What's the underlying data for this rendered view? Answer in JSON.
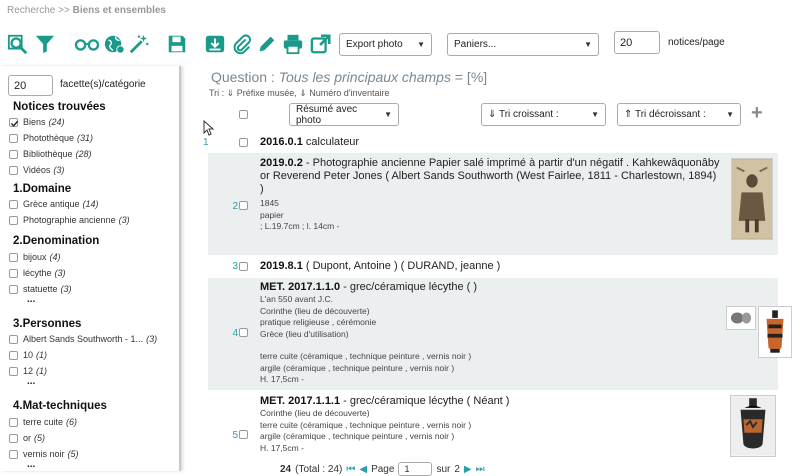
{
  "breadcrumb": {
    "root": "Recherche",
    "sep": ">>",
    "current": "Biens et ensembles"
  },
  "toolbar": {
    "export_photo": "Export photo",
    "paniers": "Paniers...",
    "per_page_value": "20",
    "per_page_label": "notices/page"
  },
  "sidebar": {
    "facet_count_value": "20",
    "facet_label": "facette(s)/catégorie",
    "found_title": "Notices trouvées",
    "found_items": [
      {
        "label": "Biens",
        "count": "(24)",
        "checked": true
      },
      {
        "label": "Photothèque",
        "count": "(31)"
      },
      {
        "label": "Bibliothèque",
        "count": "(28)"
      },
      {
        "label": "Vidéos",
        "count": "(3)"
      }
    ],
    "domaine_title": "1.Domaine",
    "domaine_items": [
      {
        "label": "Grèce antique",
        "count": "(14)"
      },
      {
        "label": "Photographie ancienne",
        "count": "(3)"
      }
    ],
    "denom_title": "2.Denomination",
    "denom_items": [
      {
        "label": "bijoux",
        "count": "(4)"
      },
      {
        "label": "lécythe",
        "count": "(3)"
      },
      {
        "label": "statuette",
        "count": "(3)"
      }
    ],
    "pers_title": "3.Personnes",
    "pers_items": [
      {
        "label": "Albert Sands Southworth - 1...",
        "count": "(3)"
      },
      {
        "label": "10",
        "count": "(1)"
      },
      {
        "label": "12",
        "count": "(1)"
      }
    ],
    "mat_title": "4.Mat-techniques",
    "mat_items": [
      {
        "label": "terre cuite",
        "count": "(6)"
      },
      {
        "label": "or",
        "count": "(5)"
      },
      {
        "label": "vernis noir",
        "count": "(5)"
      }
    ],
    "more": "..."
  },
  "main": {
    "question_prefix": "Question :",
    "question_query": "Tous les principaux champs",
    "question_suffix": "= [%]",
    "tri": "Tri : ⇓ Préfixe musée, ⇓ Numéro d'inventaire",
    "resume_select": "Résumé avec photo",
    "tri_croissant": "⇓ Tri croissant :",
    "tri_decroissant": "⇑ Tri décroissant :",
    "add": "+"
  },
  "results": [
    {
      "num": "1",
      "inv": "2016.0.1",
      "title": "calculateur"
    },
    {
      "num": "2",
      "inv": "2019.0.2",
      "title": "- Photographie ancienne Papier salé imprimé à partir d'un négatif . Kahkewâquonâby or Reverend Peter Jones ( Albert Sands Southworth (West Fairlee, 1811 - Charlestown, 1894) )",
      "meta": [
        "1845",
        "papier",
        " ; L.19.7cm ; l. 14cm -"
      ]
    },
    {
      "num": "3",
      "inv": "2019.8.1",
      "title": "( Dupont, Antoine ) ( DURAND, jeanne )"
    },
    {
      "num": "4",
      "inv": "MET. 2017.1.1.0",
      "title": "- grec/céramique lécythe ( )",
      "meta": [
        "L'an 550 avant J.C.",
        "Corinthe (lieu de découverte)",
        "pratique religieuse , cérémonie",
        "Grèce (lieu d'utilisation)",
        "",
        "terre cuite (céramique , technique peinture , vernis noir )",
        "argile (céramique , technique peinture , vernis noir )",
        "H. 17,5cm -"
      ]
    },
    {
      "num": "5",
      "inv": "MET. 2017.1.1.1",
      "title": "- grec/céramique lécythe ( Néant )",
      "meta": [
        "Corinthe (lieu de découverte)",
        "terre cuite (céramique , technique peinture , vernis noir )",
        "argile (céramique , technique peinture , vernis noir )",
        "H. 17,5cm -"
      ]
    }
  ],
  "pager": {
    "count": "24",
    "total": "(Total : 24)",
    "page_label": "Page",
    "page_value": "1",
    "of_label": "sur",
    "of_value": "2"
  },
  "colors": {
    "accent": "#1a9a8a",
    "rownum": "#2b9ea8",
    "shade": "#eceff0"
  }
}
